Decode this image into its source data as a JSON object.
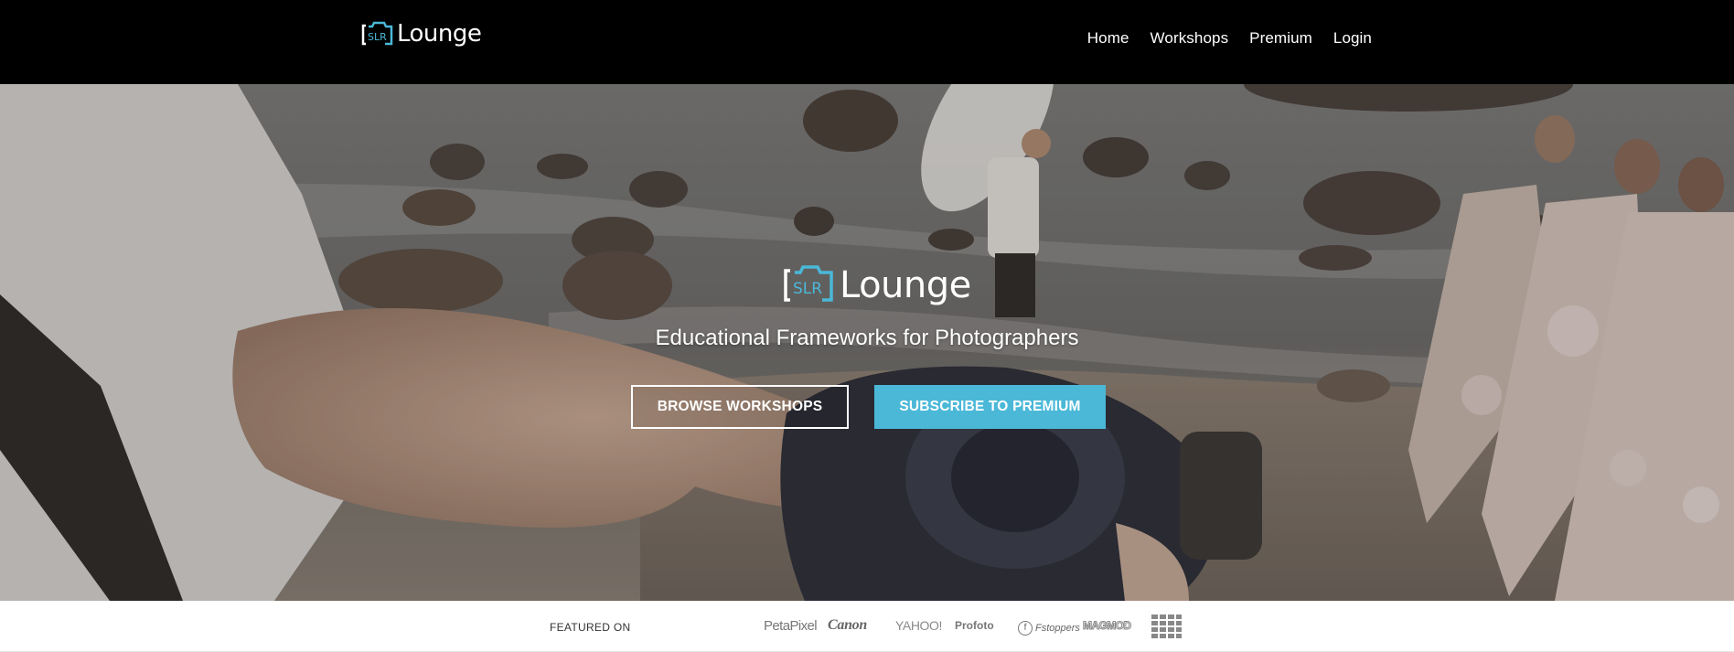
{
  "brand": {
    "logo_mark": "SLR",
    "logo_word": "Lounge",
    "accent_color": "#4bb8d8"
  },
  "nav": {
    "items": [
      {
        "label": "Home"
      },
      {
        "label": "Workshops"
      },
      {
        "label": "Premium"
      },
      {
        "label": "Login"
      }
    ]
  },
  "hero": {
    "tagline": "Educational Frameworks for Photographers",
    "browse_button": "BROWSE WORKSHOPS",
    "subscribe_button": "SUBSCRIBE TO PREMIUM"
  },
  "featured": {
    "label": "FEATURED ON",
    "outlets": [
      "PetaPixel",
      "Canon",
      "YAHOO!",
      "Profoto",
      "Fstoppers",
      "MAGMOD"
    ],
    "extra_icon": "grid-logo-icon"
  }
}
